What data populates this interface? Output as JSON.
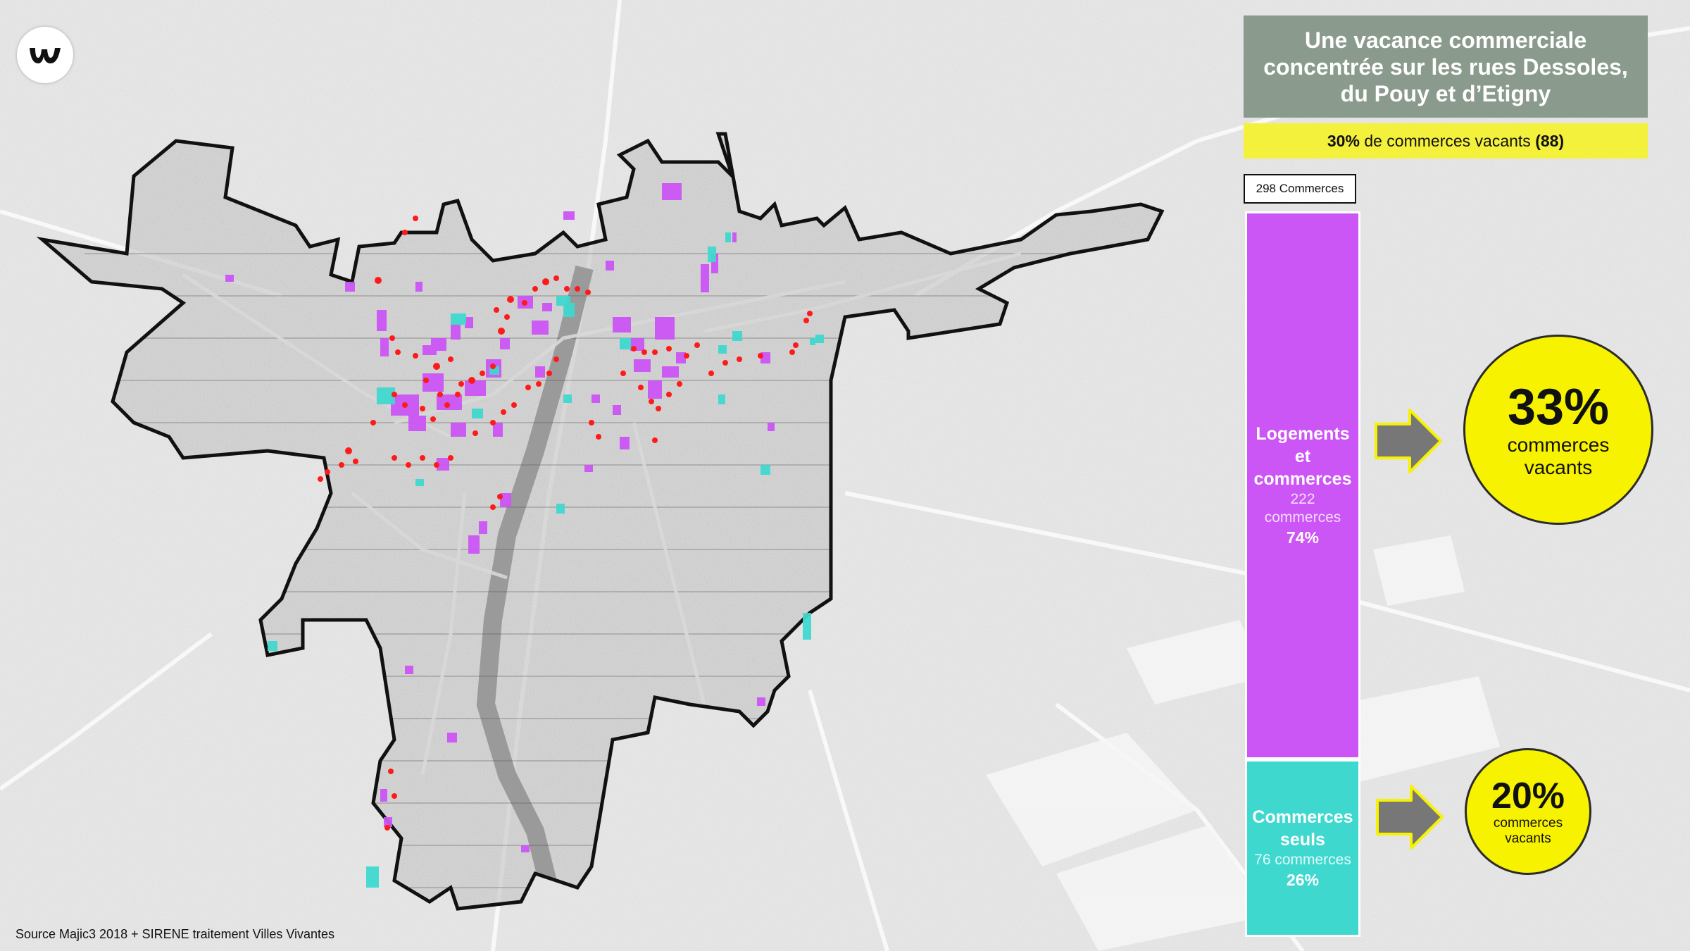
{
  "title": "Une vacance commerciale\nconcentrée sur les rues Dessoles,\ndu Pouy et d’Etigny",
  "vacancy_banner": {
    "percent": "30%",
    "text": " de commerces vacants ",
    "count": "(88)"
  },
  "total_label": "298 Commerces",
  "segments": [
    {
      "label": "Logements\net\ncommerces",
      "count": "222\ncommerces",
      "percent": "74%",
      "color": "#cc55f5",
      "share": 0.74
    },
    {
      "label": "Commerces\nseuls",
      "count": "76 commerces",
      "percent": "26%",
      "color": "#3fd8cf",
      "share": 0.26
    }
  ],
  "results": [
    {
      "value": "33%",
      "label": "commerces\nvacants"
    },
    {
      "value": "20%",
      "label": "commerces\nvacants"
    }
  ],
  "colors": {
    "accent_yellow": "#f7f200",
    "title_bg": "#8a9a8c",
    "mixed_purple": "#cc55f5",
    "shops_teal": "#3fd8cf",
    "vacant_red": "#ff1a1a"
  },
  "source": "Source Majic3 2018 + SIRENE traitement Villes Vivantes",
  "icons": {
    "logo": "villes-vivantes-logo",
    "arrow": "right-arrow-icon"
  }
}
